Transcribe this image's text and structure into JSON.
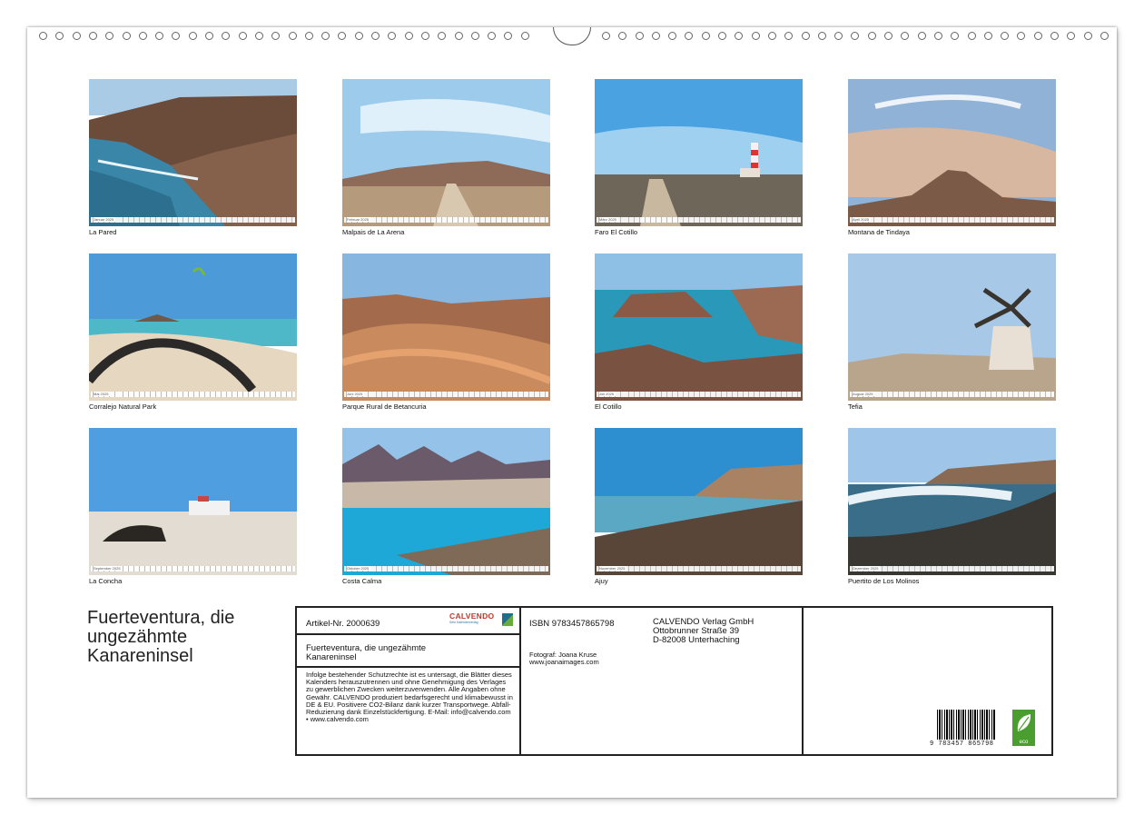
{
  "months": [
    {
      "caption": "La Pared",
      "strip": "Januar 2025"
    },
    {
      "caption": "Malpais de La Arena",
      "strip": "Februar 2025"
    },
    {
      "caption": "Faro El Cotillo",
      "strip": "März 2025"
    },
    {
      "caption": "Montana de Tindaya",
      "strip": "April 2025"
    },
    {
      "caption": "Corralejo Natural Park",
      "strip": "Mai 2025"
    },
    {
      "caption": "Parque Rural de Betancuria",
      "strip": "Juni 2025"
    },
    {
      "caption": "El Cotillo",
      "strip": "Juli 2025"
    },
    {
      "caption": "Tefia",
      "strip": "August 2025"
    },
    {
      "caption": "La Concha",
      "strip": "September 2025"
    },
    {
      "caption": "Costa Calma",
      "strip": "Oktober 2025"
    },
    {
      "caption": "Ajuy",
      "strip": "November 2025"
    },
    {
      "caption": "Puertito de Los Molinos",
      "strip": "Dezember 2025"
    }
  ],
  "calendar_title": "Fuerteventura, die ungezähmte Kanareninsel",
  "info": {
    "article": "Artikel-Nr. 2000639",
    "logo": "CALVENDO",
    "logo_sub": "Sein Kalenderverlag",
    "product_title": "Fuerteventura, die ungezähmte Kanareninsel",
    "legal": "Infolge bestehender Schutzrechte ist es untersagt, die Blätter dieses Kalenders herauszutrennen und ohne Genehmigung des Verlages zu gewerblichen Zwecken weiterzuverwenden. Alle Angaben ohne Gewähr. CALVENDO produziert bedarfsgerecht und klimabewusst in DE & EU. Positivere CO2-Bilanz dank kurzer Transportwege. Abfall-Reduzierung dank Einzelstückfertigung. E-Mail: info@calvendo.com • www.calvendo.com",
    "isbn": "ISBN 9783457865798",
    "publisher_name": "CALVENDO Verlag GmbH",
    "publisher_street": "Ottobrunner Straße 39",
    "publisher_city": "D-82008 Unterhaching",
    "photographer": "Fotograf: Joana Kruse",
    "photographer_web": "www.joanaimages.com",
    "barcode_number": "9 783457 865798",
    "eco_label": "eco"
  },
  "colors": {
    "accent": "#c0392b",
    "eco": "#4a9e2f"
  }
}
